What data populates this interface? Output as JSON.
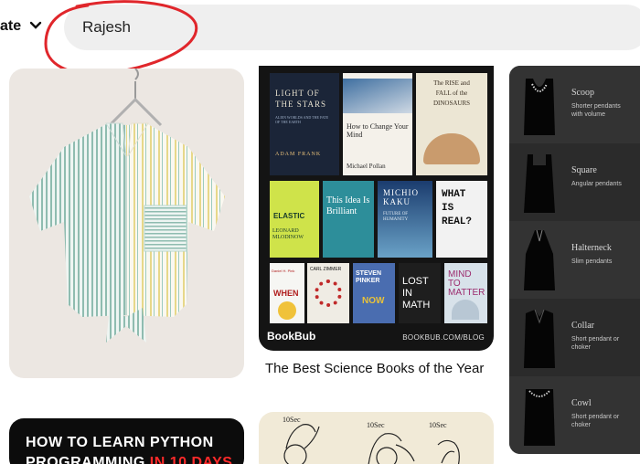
{
  "header": {
    "create_label": "ate",
    "search_value": "Rajesh"
  },
  "pins": {
    "books": {
      "covers": {
        "c1_title": "LIGHT OF THE STARS",
        "c1_sub": "ALIEN WORLDS AND THE FATE OF THE EARTH",
        "c1_author": "ADAM FRANK",
        "c2_title": "How to Change Your Mind",
        "c2_author": "Michael Pollan",
        "c3_title": "The RISE and FALL of the DINOSAURS",
        "c4_title": "ELASTIC",
        "c4_author": "LEONARD MLODINOW",
        "c5_title": "This Idea Is Brilliant",
        "c6_author": "MICHIO KAKU",
        "c6_title": "FUTURE OF HUMANITY",
        "c7_title": "WHAT IS REAL?",
        "c8_title": "WHEN",
        "c8_author": "Daniel H. Pink",
        "c9_author": "CARL ZIMMER",
        "c10_author": "STEVEN PINKER",
        "c10_title": "NOW",
        "c11_title": "LOST IN MATH",
        "c12_title": "MIND TO MATTER"
      },
      "brand": "BookBub",
      "url": "BOOKBUB.COM/BLOG",
      "title": "The Best Science Books of the Year"
    },
    "necklines": [
      {
        "name": "Scoop",
        "desc": "Shorter pendants with volume"
      },
      {
        "name": "Square",
        "desc": "Angular pendants"
      },
      {
        "name": "Halterneck",
        "desc": "Slim pendants"
      },
      {
        "name": "Collar",
        "desc": "Short pendant or choker"
      },
      {
        "name": "Cowl",
        "desc": "Short pendant or choker"
      }
    ],
    "python": {
      "line1": "HOW TO LEARN PYTHON",
      "line2a": "PROGRAMMING ",
      "line2b": "IN 10 DAYS"
    },
    "sketch": {
      "t1": "10Sec",
      "t2": "10Sec",
      "t3": "10Sec"
    }
  }
}
